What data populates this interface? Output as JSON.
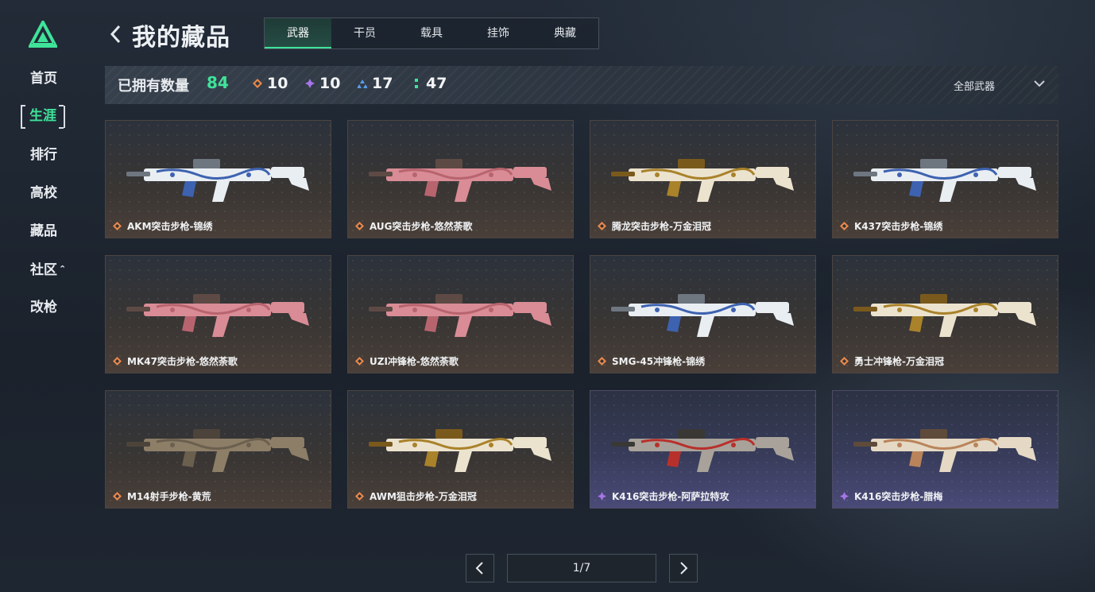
{
  "sidebar": {
    "items": [
      {
        "label": "首页"
      },
      {
        "label": "生涯"
      },
      {
        "label": "排行"
      },
      {
        "label": "高校"
      },
      {
        "label": "藏品"
      },
      {
        "label": "社区"
      },
      {
        "label": "改枪"
      }
    ],
    "active_index": 1,
    "accent": "#3fe39a"
  },
  "header": {
    "title": "我的藏品",
    "tabs": [
      {
        "label": "武器"
      },
      {
        "label": "干员"
      },
      {
        "label": "载具"
      },
      {
        "label": "挂饰"
      },
      {
        "label": "典藏"
      }
    ],
    "active_tab": 0
  },
  "stats": {
    "owned_label": "已拥有数量",
    "owned_count": "84",
    "orange": "10",
    "purple": "10",
    "blue": "17",
    "green": "47"
  },
  "filter": {
    "selected": "全部武器"
  },
  "rarity_colors": {
    "orange": "#e8884a",
    "purple": "#a775e8",
    "blue": "#5a9ce8",
    "green": "#3fe39a"
  },
  "items": [
    {
      "name": "AKM突击步枪-锦绣",
      "rarity": "orange",
      "skin": "blue"
    },
    {
      "name": "AUG突击步枪-悠然荼歌",
      "rarity": "orange",
      "skin": "pink"
    },
    {
      "name": "腾龙突击步枪-万金泪冠",
      "rarity": "orange",
      "skin": "gold"
    },
    {
      "name": "K437突击步枪-锦绣",
      "rarity": "orange",
      "skin": "blue"
    },
    {
      "name": "MK47突击步枪-悠然荼歌",
      "rarity": "orange",
      "skin": "pink"
    },
    {
      "name": "UZI冲锋枪-悠然荼歌",
      "rarity": "orange",
      "skin": "pink"
    },
    {
      "name": "SMG-45冲锋枪-锦绣",
      "rarity": "orange",
      "skin": "blue"
    },
    {
      "name": "勇士冲锋枪-万金泪冠",
      "rarity": "orange",
      "skin": "gold"
    },
    {
      "name": "M14射手步枪-黄荒",
      "rarity": "orange",
      "skin": "tan"
    },
    {
      "name": "AWM狙击步枪-万金泪冠",
      "rarity": "orange",
      "skin": "gold"
    },
    {
      "name": "K416突击步枪-阿萨拉特攻",
      "rarity": "purple",
      "skin": "red"
    },
    {
      "name": "K416突击步枪-腊梅",
      "rarity": "purple",
      "skin": "cream"
    }
  ],
  "pagination": {
    "indicator": "1/7"
  }
}
